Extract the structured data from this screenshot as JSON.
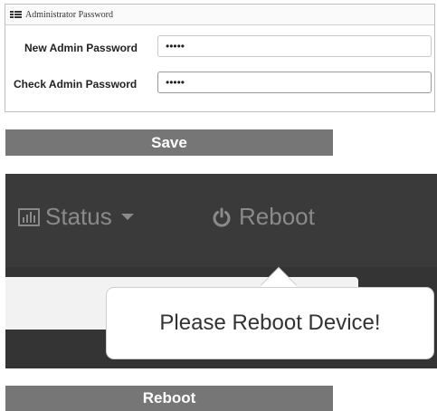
{
  "panel": {
    "title": "Administrator Password",
    "fields": [
      {
        "label": "New Admin Password",
        "value": "•••••"
      },
      {
        "label": "Check Admin Password",
        "value": "•••••"
      }
    ]
  },
  "buttons": {
    "save_label": "Save",
    "reboot_label": "Reboot"
  },
  "navbar": {
    "status_label": "Status",
    "reboot_label": "Reboot",
    "tooltip_text": "Please Reboot Device!"
  },
  "colors": {
    "button_bg": "#767676",
    "navbar_bg": "#3a3a3a",
    "nav_text": "#8a8a8a"
  }
}
